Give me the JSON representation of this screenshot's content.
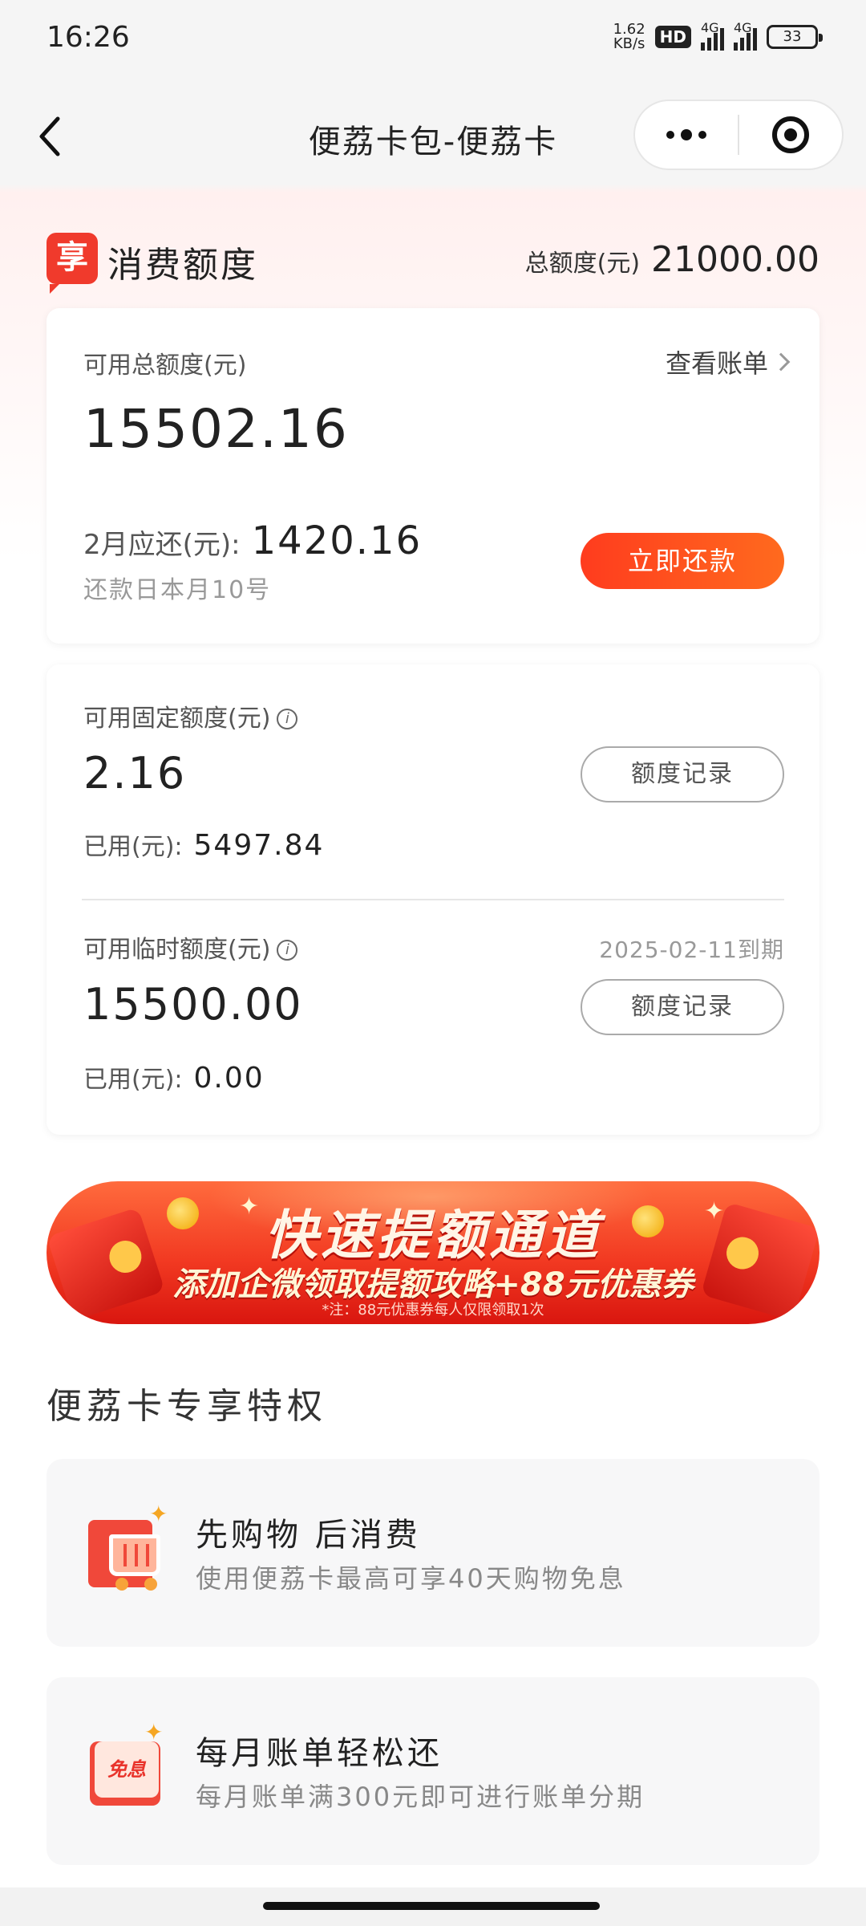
{
  "status_bar": {
    "time": "16:26",
    "net_speed": "1.62",
    "net_unit": "KB/s",
    "hd": "HD",
    "signal1_label": "4G",
    "signal2_label": "4G",
    "battery": "33"
  },
  "nav": {
    "title": "便荔卡包-便荔卡"
  },
  "quota": {
    "icon_char": "享",
    "title": "消费额度",
    "total_label": "总额度(元)",
    "total_value": "21000.00"
  },
  "summary_card": {
    "available_label": "可用总额度(元)",
    "available_value": "15502.16",
    "view_bill": "查看账单",
    "due_label": "2月应还(元):",
    "due_value": "1420.16",
    "due_date": "还款日本月10号",
    "repay_button": "立即还款"
  },
  "fixed_quota": {
    "label": "可用固定额度(元)",
    "value": "2.16",
    "used_label": "已用(元):",
    "used_value": "5497.84",
    "record_button": "额度记录"
  },
  "temp_quota": {
    "label": "可用临时额度(元)",
    "expiry": "2025-02-11到期",
    "value": "15500.00",
    "used_label": "已用(元):",
    "used_value": "0.00",
    "record_button": "额度记录"
  },
  "banner": {
    "title": "快速提额通道",
    "subtitle": "添加企微领取提额攻略+88元优惠券",
    "note": "*注：88元优惠券每人仅限领取1次"
  },
  "privileges": {
    "title": "便荔卡专享特权",
    "items": [
      {
        "name": "先购物  后消费",
        "desc": "使用便荔卡最高可享40天购物免息",
        "icon": "shopping-cart-icon"
      },
      {
        "name": "每月账单轻松还",
        "desc": "每月账单满300元即可进行账单分期",
        "icon_text": "免息",
        "icon": "interest-free-icon"
      }
    ]
  },
  "colors": {
    "accent": "#f03a2c",
    "repay_gradient_start": "#ff3c1e",
    "repay_gradient_end": "#ff6a1e"
  }
}
